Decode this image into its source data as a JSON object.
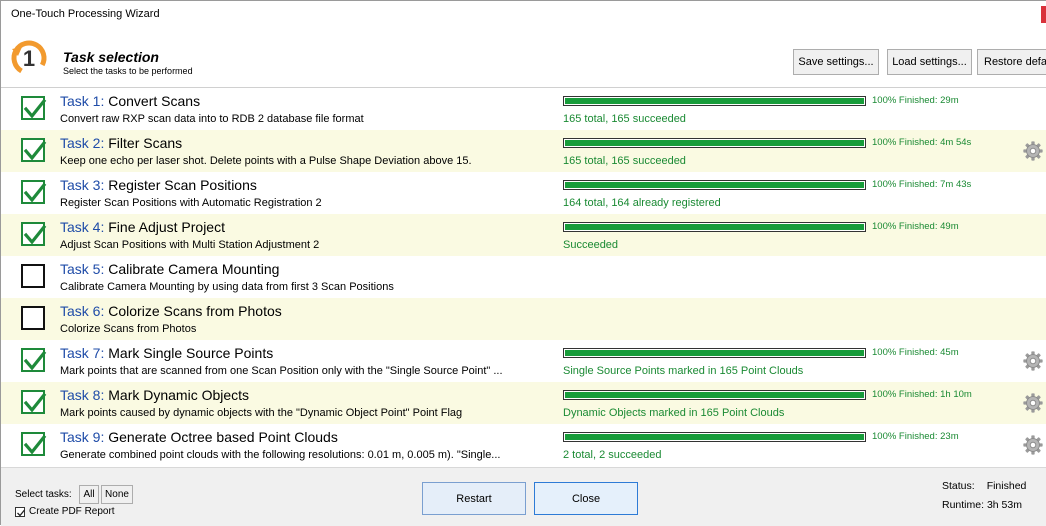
{
  "window": {
    "title": "One-Touch Processing Wizard"
  },
  "header": {
    "title": "Task selection",
    "subtitle": "Select the tasks to be performed",
    "logo_number": "1",
    "save_label": "Save settings...",
    "load_label": "Load settings...",
    "restore_label": "Restore defaul"
  },
  "tasks": [
    {
      "num": "Task 1:",
      "name": "Convert Scans",
      "desc": "Convert raw RXP scan data into to RDB 2 database file format",
      "checked": true,
      "progress": 1.0,
      "pct": "100%  Finished: 29m",
      "summary": "165 total, 165 succeeded",
      "gear": false
    },
    {
      "num": "Task 2:",
      "name": "Filter Scans",
      "desc": "Keep one echo per laser shot. Delete points with a Pulse Shape Deviation above 15.",
      "checked": true,
      "progress": 1.0,
      "pct": "100%  Finished: 4m 54s",
      "summary": "165 total, 165 succeeded",
      "gear": true
    },
    {
      "num": "Task 3:",
      "name": "Register Scan Positions",
      "desc": "Register Scan Positions with Automatic Registration 2",
      "checked": true,
      "progress": 1.0,
      "pct": "100%  Finished: 7m 43s",
      "summary": "164 total, 164 already registered",
      "gear": false
    },
    {
      "num": "Task 4:",
      "name": "Fine Adjust Project",
      "desc": "Adjust Scan Positions with Multi Station Adjustment 2",
      "checked": true,
      "progress": 1.0,
      "pct": "100%  Finished: 49m",
      "summary": "Succeeded",
      "gear": false
    },
    {
      "num": "Task 5:",
      "name": "Calibrate Camera Mounting",
      "desc": "Calibrate Camera Mounting by using data from first 3 Scan Positions",
      "checked": false,
      "progress": null,
      "pct": "",
      "summary": "",
      "gear": false
    },
    {
      "num": "Task 6:",
      "name": "Colorize Scans from Photos",
      "desc": "Colorize Scans from Photos",
      "checked": false,
      "progress": null,
      "pct": "",
      "summary": "",
      "gear": false
    },
    {
      "num": "Task 7:",
      "name": "Mark Single Source Points",
      "desc": "Mark points that are scanned from one Scan Position only with the \"Single Source Point\" ...",
      "checked": true,
      "progress": 1.0,
      "pct": "100%  Finished: 45m",
      "summary": "Single Source Points marked in 165 Point Clouds",
      "gear": true
    },
    {
      "num": "Task 8:",
      "name": "Mark Dynamic Objects",
      "desc": "Mark points caused by dynamic objects with the \"Dynamic Object Point\" Point Flag",
      "checked": true,
      "progress": 1.0,
      "pct": "100%  Finished: 1h 10m",
      "summary": "Dynamic Objects marked in 165 Point Clouds",
      "gear": true
    },
    {
      "num": "Task 9:",
      "name": "Generate Octree based Point Clouds",
      "desc": "Generate combined point clouds with the following resolutions: 0.01 m, 0.005 m). \"Single...",
      "checked": true,
      "progress": 1.0,
      "pct": "100%  Finished: 23m",
      "summary": "2 total, 2 succeeded",
      "gear": true
    }
  ],
  "footer": {
    "select_label": "Select tasks:",
    "all_label": "All",
    "none_label": "None",
    "pdf_label": "Create PDF Report",
    "pdf_checked": true,
    "restart_label": "Restart",
    "close_label": "Close",
    "status_label": "Status:",
    "status_value": "Finished",
    "runtime_label": "Runtime:",
    "runtime_value": "3h 53m"
  },
  "colors": {
    "accent_green": "#179c3a",
    "task_number_blue": "#1f4ca8",
    "alt_row": "#fafae2",
    "close_red": "#d9313b"
  },
  "icons": {
    "logo": "orange-circle-arrow-1-icon",
    "checkbox_checked": "green-check-icon",
    "settings": "gear-icon"
  }
}
